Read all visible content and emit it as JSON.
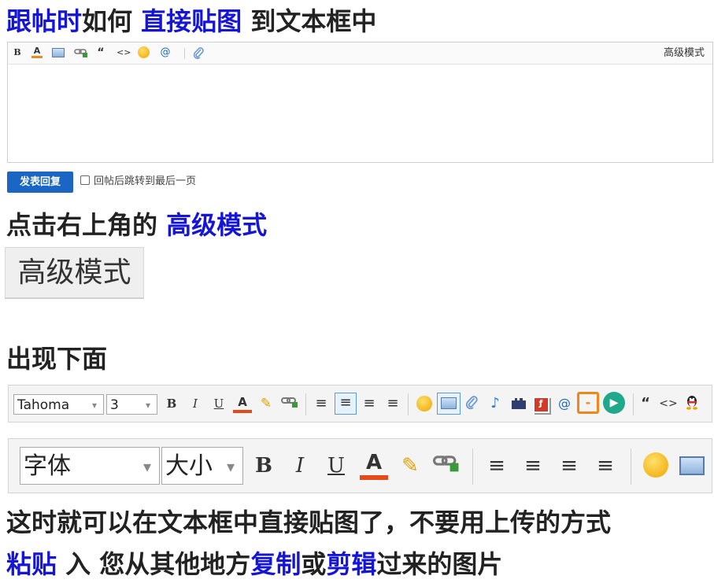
{
  "heading1": {
    "part1": "跟帖时",
    "part2": "如何 ",
    "part3": "直接贴图",
    "part4": " 到文本框中"
  },
  "editor": {
    "icons": [
      "bold-icon",
      "font-color-icon",
      "image-icon",
      "link-icon",
      "quote-icon",
      "code-icon",
      "emoji-icon",
      "mention-icon",
      "attachment-icon"
    ],
    "glyphs": [
      "B",
      "A",
      "",
      "",
      "“",
      "<>",
      "☻",
      "@",
      "⌒"
    ],
    "advanced_mode": "高级模式"
  },
  "submit_button": "发表回复",
  "jump_option": "回帖后跳转到最后一页",
  "heading2": {
    "part1": "点击右上角的 ",
    "part2": "高级模式"
  },
  "advanced_button": "高级模式",
  "heading3": {
    "text": "出现下面"
  },
  "toolbar_small": {
    "font_value": "Tahoma",
    "size_value": "3"
  },
  "toolbar_large": {
    "font_value": "字体",
    "size_value": "大小"
  },
  "heading4": {
    "text": "这时就可以在文本框中直接贴图了，不要用上传的方式"
  },
  "heading5": {
    "part1": "粘贴",
    "part2": " 入 您从其他地方",
    "part3": "复制",
    "part4": "或",
    "part5": "剪辑",
    "part6": "过来的图片"
  },
  "colors": {
    "highlight": "#1515d6",
    "button": "#1a66c2",
    "text": "#222222"
  }
}
